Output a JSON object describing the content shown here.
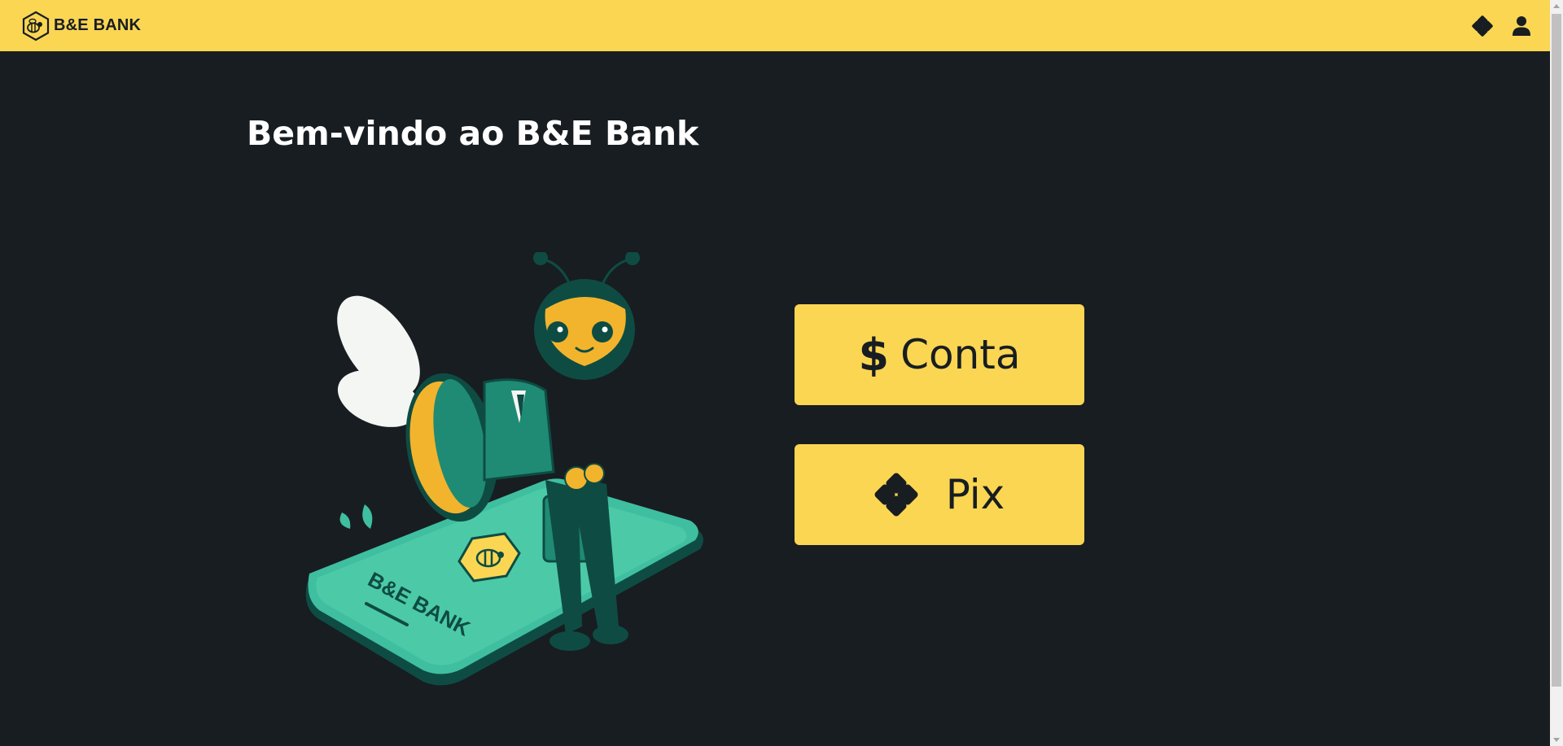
{
  "header": {
    "brand_name": "B&E BANK",
    "icons": [
      "bee-logo-icon",
      "pix-icon",
      "user-icon"
    ]
  },
  "main": {
    "title": "Bem-vindo ao B&E Bank",
    "hero_phone_label": "B&E BANK",
    "buttons": [
      {
        "symbol": "$",
        "label": "Conta",
        "icon": "dollar-icon"
      },
      {
        "label": "Pix",
        "icon": "pix-icon"
      }
    ]
  },
  "colors": {
    "background": "#181d21",
    "accent": "#fad653",
    "teal": "#3fbf9f",
    "dark_green": "#0b4a40"
  }
}
